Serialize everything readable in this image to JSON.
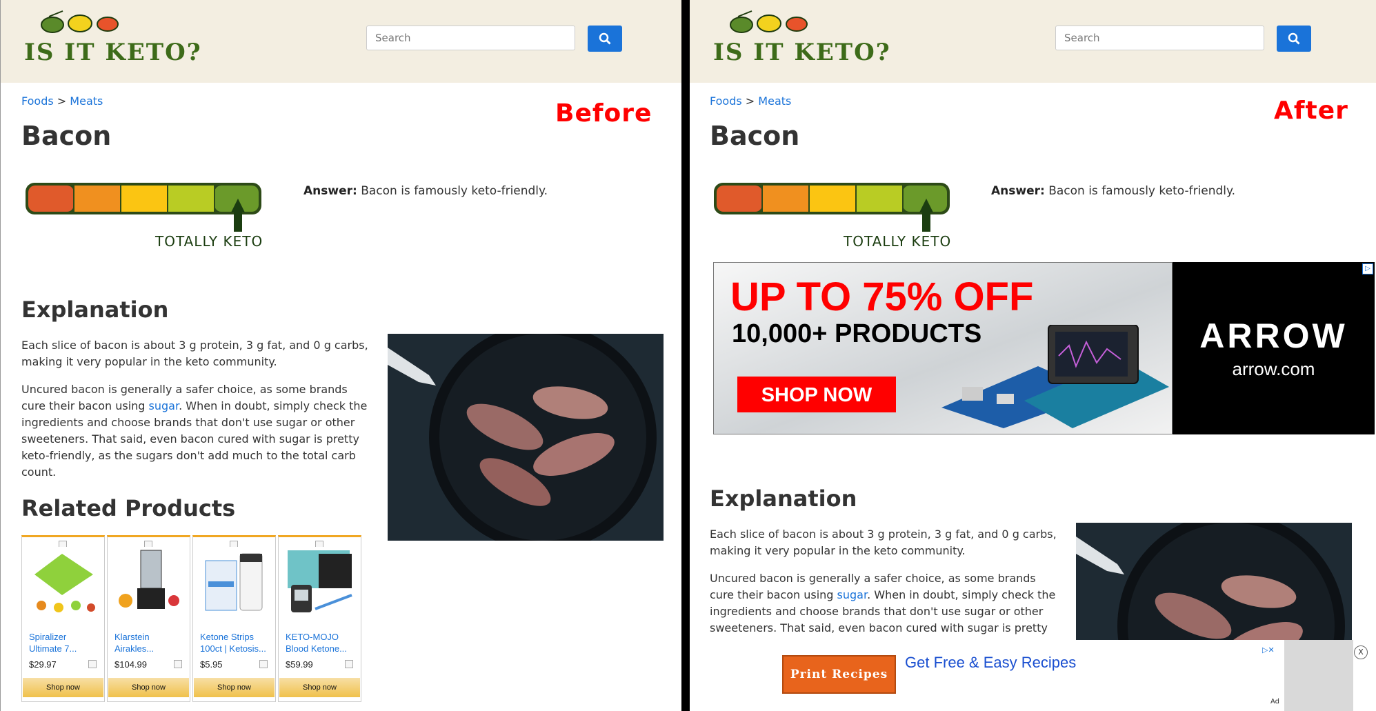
{
  "site": {
    "logo_text": "IS IT KETO?",
    "search_placeholder": "Search"
  },
  "labels": {
    "before": "Before",
    "after": "After"
  },
  "breadcrumb": {
    "items": [
      "Foods",
      "Meats"
    ],
    "separator": ">"
  },
  "food": {
    "title": "Bacon",
    "rating_label": "TOTALLY KETO",
    "rating_level": 5,
    "rating_max": 5,
    "answer_label": "Answer:",
    "answer_text": "Bacon is famously keto-friendly."
  },
  "explanation": {
    "heading": "Explanation",
    "p1": "Each slice of bacon is about 3 g protein, 3 g fat, and 0 g carbs, making it very popular in the keto community.",
    "p2_before": "Uncured bacon is generally a safer choice, as some brands cure their bacon using ",
    "p2_link": "sugar",
    "p2_after": ". When in doubt, simply check the ingredients and choose brands that don't use sugar or other sweeteners. That said, even bacon cured with sugar is pretty keto-friendly, as the sugars don't add much to the total carb count."
  },
  "related": {
    "heading": "Related Products",
    "products": [
      {
        "name": "Spiralizer Ultimate 7...",
        "price": "$29.97",
        "button": "Shop now"
      },
      {
        "name": "Klarstein Airakles...",
        "price": "$104.99",
        "button": "Shop now"
      },
      {
        "name": "Ketone Strips 100ct | Ketosis...",
        "price": "$5.95",
        "button": "Shop now"
      },
      {
        "name": "KETO-MOJO Blood Ketone...",
        "price": "$59.99",
        "button": "Shop now"
      }
    ]
  },
  "banner_ad": {
    "headline": "UP TO 75% OFF",
    "subline": "10,000+ PRODUCTS",
    "cta": "SHOP NOW",
    "brand": "ARROW",
    "domain": "arrow.com",
    "choices_icon": "adchoices-icon"
  },
  "bottom_ad": {
    "button": "Print Recipes",
    "link": "Get Free & Easy Recipes",
    "ad_label": "Ad",
    "close": "X"
  },
  "colors": {
    "header_bg": "#f3eee1",
    "link": "#1a73d9",
    "meter": [
      "#e05a2b",
      "#f0901f",
      "#fbc512",
      "#b9cc24",
      "#6b9a2a"
    ],
    "stamp": "#ff0000"
  }
}
